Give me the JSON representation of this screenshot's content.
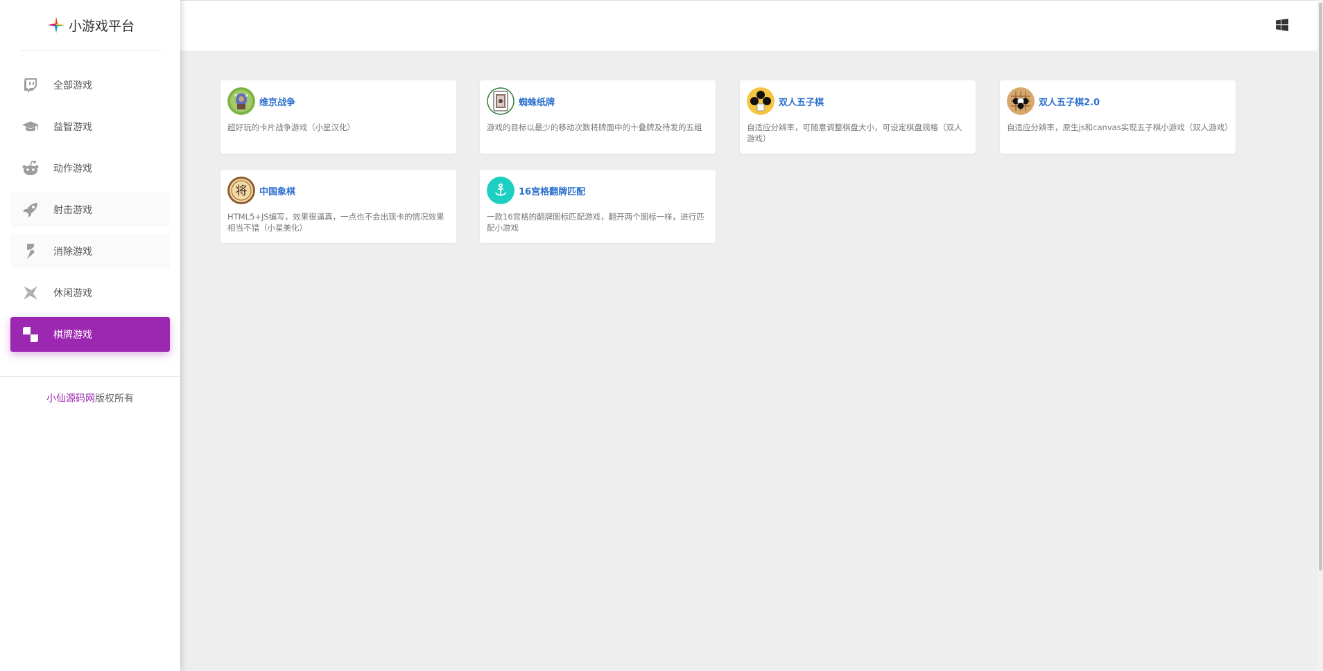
{
  "app": {
    "title": "小游戏平台"
  },
  "sidebar": {
    "items": [
      {
        "label": "全部游戏",
        "icon": "twitch-icon"
      },
      {
        "label": "益智游戏",
        "icon": "graduation-cap-icon"
      },
      {
        "label": "动作游戏",
        "icon": "reddit-icon"
      },
      {
        "label": "射击游戏",
        "icon": "rocket-icon"
      },
      {
        "label": "消除游戏",
        "icon": "bolt-icon"
      },
      {
        "label": "休闲游戏",
        "icon": "pinwheel-icon"
      },
      {
        "label": "棋牌游戏",
        "icon": "checkerboard-icon"
      }
    ],
    "active_index": 6,
    "copyright_link": "小仙源码网",
    "copyright_suffix": "版权所有"
  },
  "games": [
    {
      "title": "维京战争",
      "desc": "超好玩的卡片战争游戏（小星汉化）",
      "thumb": "viking-thumb"
    },
    {
      "title": "蜘蛛纸牌",
      "desc": "游戏的目标以最少的移动次数将牌面中的十叠牌及待发的五组",
      "thumb": "spider-card-thumb"
    },
    {
      "title": "双人五子棋",
      "desc": "自适应分辨率，可随意调整棋盘大小，可设定棋盘规格（双人游戏）",
      "thumb": "gomoku-thumb"
    },
    {
      "title": "双人五子棋2.0",
      "desc": "自适应分辨率，原生js和canvas实现五子棋小游戏（双人游戏）",
      "thumb": "gomoku2-thumb"
    },
    {
      "title": "中国象棋",
      "desc": "HTML5+JS编写，效果很逼真，一点也不会出现卡的情况效果相当不错（小星美化）",
      "thumb": "chinese-chess-thumb"
    },
    {
      "title": "16宫格翻牌匹配",
      "desc": "一款16宫格的翻牌图标匹配游戏，翻开两个图标一样，进行匹配小游戏",
      "thumb": "anchor-thumb"
    }
  ],
  "colors": {
    "accent": "#9c27b0",
    "title_blue": "#2b6fce",
    "background": "#eeeeee"
  }
}
